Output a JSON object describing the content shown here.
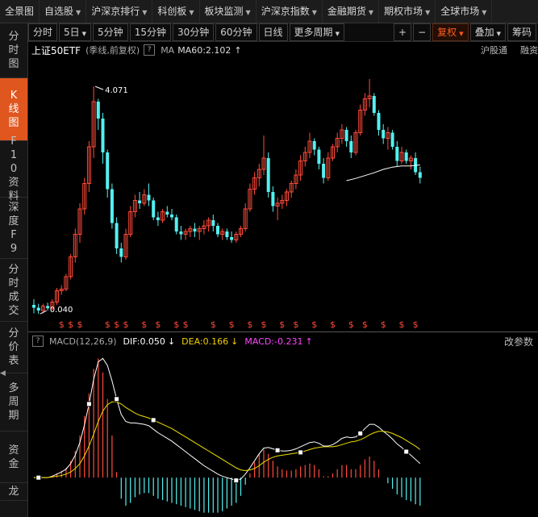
{
  "topnav": {
    "items": [
      {
        "label": "全景图",
        "caret": false
      },
      {
        "label": "自选股",
        "caret": true
      },
      {
        "label": "沪深京排行",
        "caret": true
      },
      {
        "label": "科创板",
        "caret": true
      },
      {
        "label": "板块监测",
        "caret": true
      },
      {
        "label": "沪深京指数",
        "caret": true
      },
      {
        "label": "金融期货",
        "caret": true
      },
      {
        "label": "期权市场",
        "caret": true
      },
      {
        "label": "全球市场",
        "caret": true
      }
    ]
  },
  "sidebar": {
    "items": [
      {
        "label": "分时图",
        "active": false,
        "h": 68
      },
      {
        "label": "K线图",
        "active": true,
        "h": 78
      },
      {
        "label": "F10资料",
        "active": false,
        "h": 70
      },
      {
        "label": "深度F9",
        "active": false,
        "h": 76
      },
      {
        "label": "分时成交",
        "active": false,
        "h": 78
      },
      {
        "label": "分价表",
        "active": false,
        "h": 64
      },
      {
        "label": "多周期",
        "active": false,
        "h": 72
      },
      {
        "label": "资金",
        "active": false,
        "h": 64
      },
      {
        "label": "龙",
        "active": false,
        "h": 22
      }
    ]
  },
  "toolbar": {
    "periods": [
      {
        "label": "分时",
        "caret": false
      },
      {
        "label": "5日",
        "caret": true
      },
      {
        "label": "5分钟",
        "caret": false
      },
      {
        "label": "15分钟",
        "caret": false
      },
      {
        "label": "30分钟",
        "caret": false
      },
      {
        "label": "60分钟",
        "caret": false
      },
      {
        "label": "日线",
        "caret": false
      },
      {
        "label": "更多周期",
        "caret": true
      }
    ],
    "plus": "+",
    "minus": "−",
    "fuquan": "复权",
    "diejia": "叠加",
    "chouma": "筹码"
  },
  "info": {
    "title": "上证50ETF",
    "sub": "(季线,前复权)",
    "q": "?",
    "ma_label": "MA",
    "ma_value": "MA60:2.102",
    "ma_arrow": "↑",
    "link1": "沪股通",
    "link2": "融资"
  },
  "price": {
    "high_label": "4.071",
    "low_label": "0.040",
    "marker_symbol": "$"
  },
  "macd": {
    "q": "?",
    "label": "MACD(12,26,9)",
    "dif": "DIF:0.050",
    "dif_arrow": "↓",
    "dea": "DEA:0.166",
    "dea_arrow": "↓",
    "macd": "MACD:-0.231",
    "macd_arrow": "↑",
    "param": "改参数"
  },
  "colors": {
    "up": "#ff4a3a",
    "down": "#54f0f0",
    "dif": "#ffffff",
    "dea": "#f0e000",
    "ma": "#ffffff",
    "accent": "#e0561f"
  },
  "chart_data": {
    "type": "candlestick",
    "price_range": [
      0.0,
      4.2
    ],
    "candles": [
      {
        "o": 0.2,
        "h": 0.3,
        "l": 0.05,
        "c": 0.15
      },
      {
        "o": 0.15,
        "h": 0.22,
        "l": 0.04,
        "c": 0.1
      },
      {
        "o": 0.1,
        "h": 0.22,
        "l": 0.05,
        "c": 0.18
      },
      {
        "o": 0.18,
        "h": 0.24,
        "l": 0.1,
        "c": 0.14
      },
      {
        "o": 0.14,
        "h": 0.3,
        "l": 0.1,
        "c": 0.25
      },
      {
        "o": 0.25,
        "h": 0.5,
        "l": 0.2,
        "c": 0.45
      },
      {
        "o": 0.45,
        "h": 0.55,
        "l": 0.38,
        "c": 0.48
      },
      {
        "o": 0.48,
        "h": 0.75,
        "l": 0.44,
        "c": 0.7
      },
      {
        "o": 0.7,
        "h": 1.1,
        "l": 0.65,
        "c": 1.05
      },
      {
        "o": 1.05,
        "h": 1.55,
        "l": 0.95,
        "c": 1.45
      },
      {
        "o": 1.45,
        "h": 2.0,
        "l": 1.3,
        "c": 1.9
      },
      {
        "o": 1.9,
        "h": 2.45,
        "l": 1.8,
        "c": 2.35
      },
      {
        "o": 2.35,
        "h": 3.1,
        "l": 2.2,
        "c": 3.0
      },
      {
        "o": 3.0,
        "h": 4.07,
        "l": 2.8,
        "c": 3.8
      },
      {
        "o": 3.8,
        "h": 3.85,
        "l": 3.3,
        "c": 3.5
      },
      {
        "o": 3.5,
        "h": 3.6,
        "l": 2.7,
        "c": 2.9
      },
      {
        "o": 2.9,
        "h": 2.95,
        "l": 2.1,
        "c": 2.25
      },
      {
        "o": 2.25,
        "h": 2.35,
        "l": 1.55,
        "c": 1.65
      },
      {
        "o": 1.65,
        "h": 1.75,
        "l": 1.1,
        "c": 1.2
      },
      {
        "o": 1.2,
        "h": 1.3,
        "l": 0.95,
        "c": 1.05
      },
      {
        "o": 1.05,
        "h": 1.55,
        "l": 1.0,
        "c": 1.45
      },
      {
        "o": 1.45,
        "h": 1.95,
        "l": 1.4,
        "c": 1.85
      },
      {
        "o": 1.85,
        "h": 2.15,
        "l": 1.75,
        "c": 2.05
      },
      {
        "o": 2.05,
        "h": 2.2,
        "l": 1.9,
        "c": 2.0
      },
      {
        "o": 2.0,
        "h": 2.25,
        "l": 1.95,
        "c": 2.15
      },
      {
        "o": 2.15,
        "h": 2.35,
        "l": 1.95,
        "c": 2.05
      },
      {
        "o": 2.05,
        "h": 2.1,
        "l": 1.7,
        "c": 1.75
      },
      {
        "o": 1.75,
        "h": 1.85,
        "l": 1.6,
        "c": 1.7
      },
      {
        "o": 1.7,
        "h": 1.9,
        "l": 1.65,
        "c": 1.85
      },
      {
        "o": 1.85,
        "h": 1.95,
        "l": 1.75,
        "c": 1.8
      },
      {
        "o": 1.8,
        "h": 1.9,
        "l": 1.7,
        "c": 1.75
      },
      {
        "o": 1.75,
        "h": 1.8,
        "l": 1.45,
        "c": 1.5
      },
      {
        "o": 1.5,
        "h": 1.6,
        "l": 1.35,
        "c": 1.45
      },
      {
        "o": 1.45,
        "h": 1.55,
        "l": 1.35,
        "c": 1.5
      },
      {
        "o": 1.5,
        "h": 1.6,
        "l": 1.4,
        "c": 1.55
      },
      {
        "o": 1.55,
        "h": 1.65,
        "l": 1.4,
        "c": 1.5
      },
      {
        "o": 1.5,
        "h": 1.6,
        "l": 1.35,
        "c": 1.55
      },
      {
        "o": 1.55,
        "h": 1.7,
        "l": 1.45,
        "c": 1.6
      },
      {
        "o": 1.6,
        "h": 1.75,
        "l": 1.5,
        "c": 1.7
      },
      {
        "o": 1.7,
        "h": 1.8,
        "l": 1.5,
        "c": 1.6
      },
      {
        "o": 1.6,
        "h": 1.65,
        "l": 1.4,
        "c": 1.45
      },
      {
        "o": 1.45,
        "h": 1.55,
        "l": 1.35,
        "c": 1.5
      },
      {
        "o": 1.5,
        "h": 1.55,
        "l": 1.35,
        "c": 1.4
      },
      {
        "o": 1.4,
        "h": 1.5,
        "l": 1.3,
        "c": 1.35
      },
      {
        "o": 1.35,
        "h": 1.5,
        "l": 1.3,
        "c": 1.45
      },
      {
        "o": 1.45,
        "h": 1.6,
        "l": 1.4,
        "c": 1.55
      },
      {
        "o": 1.55,
        "h": 2.0,
        "l": 1.5,
        "c": 1.9
      },
      {
        "o": 1.9,
        "h": 2.35,
        "l": 1.85,
        "c": 2.25
      },
      {
        "o": 2.25,
        "h": 2.55,
        "l": 2.15,
        "c": 2.45
      },
      {
        "o": 2.45,
        "h": 2.7,
        "l": 2.3,
        "c": 2.6
      },
      {
        "o": 2.6,
        "h": 3.2,
        "l": 2.5,
        "c": 2.8
      },
      {
        "o": 2.8,
        "h": 2.9,
        "l": 2.1,
        "c": 2.2
      },
      {
        "o": 2.2,
        "h": 2.3,
        "l": 1.85,
        "c": 1.95
      },
      {
        "o": 1.95,
        "h": 2.1,
        "l": 1.7,
        "c": 2.0
      },
      {
        "o": 2.0,
        "h": 2.15,
        "l": 1.9,
        "c": 2.05
      },
      {
        "o": 2.05,
        "h": 2.25,
        "l": 1.95,
        "c": 2.2
      },
      {
        "o": 2.2,
        "h": 2.4,
        "l": 2.1,
        "c": 2.35
      },
      {
        "o": 2.35,
        "h": 2.6,
        "l": 2.25,
        "c": 2.5
      },
      {
        "o": 2.5,
        "h": 2.85,
        "l": 2.4,
        "c": 2.75
      },
      {
        "o": 2.75,
        "h": 3.0,
        "l": 2.65,
        "c": 2.9
      },
      {
        "o": 2.9,
        "h": 3.25,
        "l": 2.8,
        "c": 3.1
      },
      {
        "o": 3.1,
        "h": 3.15,
        "l": 2.85,
        "c": 2.95
      },
      {
        "o": 2.95,
        "h": 3.0,
        "l": 2.6,
        "c": 2.7
      },
      {
        "o": 2.7,
        "h": 2.8,
        "l": 2.35,
        "c": 2.45
      },
      {
        "o": 2.45,
        "h": 2.9,
        "l": 2.4,
        "c": 2.8
      },
      {
        "o": 2.8,
        "h": 3.05,
        "l": 2.75,
        "c": 3.0
      },
      {
        "o": 3.0,
        "h": 3.25,
        "l": 2.9,
        "c": 3.15
      },
      {
        "o": 3.15,
        "h": 3.4,
        "l": 3.05,
        "c": 3.3
      },
      {
        "o": 3.3,
        "h": 3.35,
        "l": 3.0,
        "c": 3.1
      },
      {
        "o": 3.1,
        "h": 3.2,
        "l": 2.8,
        "c": 2.9
      },
      {
        "o": 2.9,
        "h": 3.3,
        "l": 2.85,
        "c": 3.25
      },
      {
        "o": 3.25,
        "h": 3.75,
        "l": 3.2,
        "c": 3.65
      },
      {
        "o": 3.65,
        "h": 3.95,
        "l": 3.55,
        "c": 3.85
      },
      {
        "o": 3.85,
        "h": 4.2,
        "l": 3.7,
        "c": 3.9
      },
      {
        "o": 3.9,
        "h": 3.95,
        "l": 3.55,
        "c": 3.6
      },
      {
        "o": 3.6,
        "h": 3.65,
        "l": 3.2,
        "c": 3.3
      },
      {
        "o": 3.3,
        "h": 3.4,
        "l": 3.05,
        "c": 3.15
      },
      {
        "o": 3.15,
        "h": 3.35,
        "l": 2.95,
        "c": 3.25
      },
      {
        "o": 3.25,
        "h": 3.3,
        "l": 2.95,
        "c": 3.0
      },
      {
        "o": 3.0,
        "h": 3.1,
        "l": 2.65,
        "c": 2.75
      },
      {
        "o": 2.75,
        "h": 3.0,
        "l": 2.7,
        "c": 2.9
      },
      {
        "o": 2.9,
        "h": 2.95,
        "l": 2.7,
        "c": 2.75
      },
      {
        "o": 2.75,
        "h": 2.85,
        "l": 2.6,
        "c": 2.8
      },
      {
        "o": 2.8,
        "h": 2.9,
        "l": 2.5,
        "c": 2.55
      },
      {
        "o": 2.55,
        "h": 2.65,
        "l": 2.35,
        "c": 2.45
      }
    ],
    "ma60": [
      [
        68,
        2.4
      ],
      [
        70,
        2.44
      ],
      [
        72,
        2.49
      ],
      [
        74,
        2.54
      ],
      [
        76,
        2.6
      ],
      [
        78,
        2.64
      ],
      [
        80,
        2.66
      ],
      [
        82,
        2.66
      ],
      [
        84,
        2.68
      ]
    ],
    "dollar_marks": [
      6,
      8,
      10,
      16,
      18,
      20,
      24,
      27,
      31,
      33,
      39,
      43,
      47,
      50,
      54,
      57,
      61,
      65,
      69,
      72,
      76,
      80,
      83
    ],
    "macd_range": [
      -0.55,
      1.75
    ],
    "dif": [
      0.0,
      0.0,
      0.0,
      0.0,
      0.02,
      0.05,
      0.08,
      0.12,
      0.2,
      0.32,
      0.5,
      0.75,
      1.05,
      1.4,
      1.65,
      1.7,
      1.6,
      1.38,
      1.12,
      0.9,
      0.8,
      0.78,
      0.78,
      0.77,
      0.76,
      0.74,
      0.69,
      0.64,
      0.6,
      0.56,
      0.52,
      0.47,
      0.42,
      0.37,
      0.32,
      0.27,
      0.22,
      0.17,
      0.13,
      0.09,
      0.05,
      0.02,
      0.0,
      -0.02,
      -0.04,
      -0.02,
      0.05,
      0.14,
      0.24,
      0.34,
      0.42,
      0.43,
      0.41,
      0.39,
      0.38,
      0.38,
      0.39,
      0.41,
      0.44,
      0.47,
      0.5,
      0.51,
      0.49,
      0.45,
      0.45,
      0.47,
      0.51,
      0.56,
      0.58,
      0.57,
      0.58,
      0.63,
      0.7,
      0.76,
      0.76,
      0.72,
      0.66,
      0.61,
      0.55,
      0.48,
      0.43,
      0.37,
      0.32,
      0.26,
      0.2
    ],
    "dea": [
      0.0,
      0.0,
      0.0,
      0.0,
      0.01,
      0.02,
      0.03,
      0.05,
      0.08,
      0.13,
      0.2,
      0.31,
      0.45,
      0.62,
      0.8,
      0.95,
      1.04,
      1.08,
      1.08,
      1.05,
      1.0,
      0.96,
      0.92,
      0.89,
      0.87,
      0.85,
      0.82,
      0.79,
      0.76,
      0.73,
      0.7,
      0.66,
      0.62,
      0.58,
      0.54,
      0.5,
      0.46,
      0.42,
      0.38,
      0.34,
      0.3,
      0.26,
      0.22,
      0.18,
      0.14,
      0.11,
      0.1,
      0.11,
      0.13,
      0.17,
      0.22,
      0.26,
      0.29,
      0.31,
      0.32,
      0.33,
      0.34,
      0.35,
      0.36,
      0.38,
      0.4,
      0.42,
      0.43,
      0.44,
      0.44,
      0.44,
      0.45,
      0.47,
      0.49,
      0.51,
      0.52,
      0.54,
      0.57,
      0.61,
      0.64,
      0.66,
      0.66,
      0.65,
      0.63,
      0.6,
      0.57,
      0.53,
      0.49,
      0.45,
      0.4
    ],
    "hist": [
      0.0,
      0.0,
      0.0,
      0.0,
      0.02,
      0.06,
      0.1,
      0.14,
      0.24,
      0.38,
      0.6,
      0.88,
      1.2,
      1.55,
      1.7,
      1.5,
      1.12,
      0.6,
      0.08,
      -0.3,
      -0.4,
      -0.36,
      -0.28,
      -0.24,
      -0.22,
      -0.22,
      -0.26,
      -0.3,
      -0.32,
      -0.34,
      -0.36,
      -0.38,
      -0.4,
      -0.42,
      -0.44,
      -0.46,
      -0.48,
      -0.5,
      -0.5,
      -0.5,
      -0.5,
      -0.48,
      -0.44,
      -0.4,
      -0.36,
      -0.26,
      -0.1,
      0.06,
      0.22,
      0.34,
      0.4,
      0.34,
      0.24,
      0.16,
      0.12,
      0.1,
      0.1,
      0.12,
      0.16,
      0.18,
      0.2,
      0.18,
      0.12,
      0.02,
      0.02,
      0.06,
      0.12,
      0.18,
      0.18,
      0.12,
      0.12,
      0.18,
      0.26,
      0.3,
      0.24,
      0.12,
      0.0,
      -0.08,
      -0.16,
      -0.24,
      -0.28,
      -0.32,
      -0.34,
      -0.38,
      -0.4
    ],
    "dif_markers": [
      1,
      12,
      18,
      44,
      53,
      71,
      81
    ],
    "dea_markers": [
      26,
      58
    ]
  }
}
